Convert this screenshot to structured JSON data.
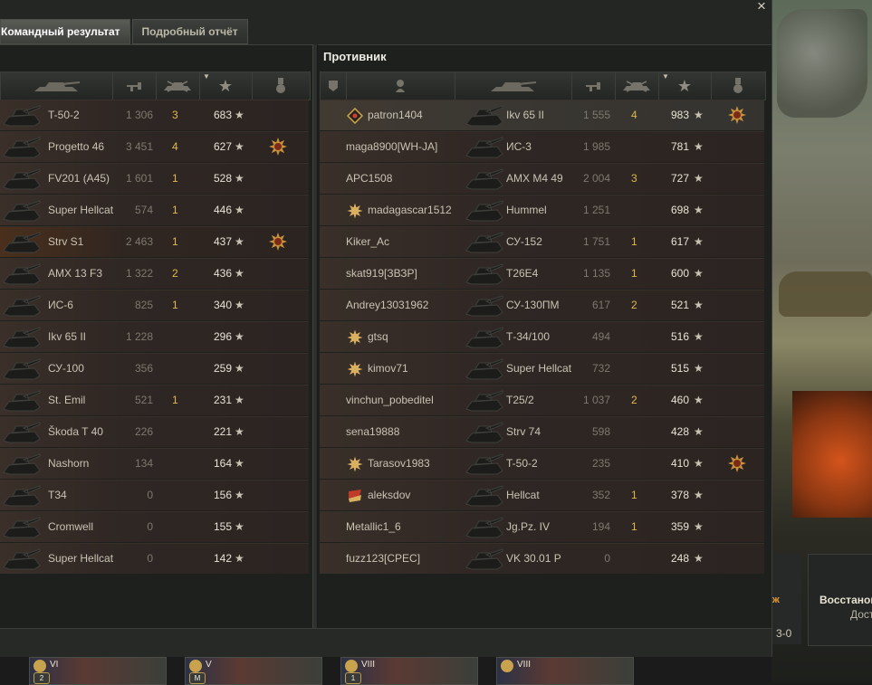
{
  "window": {
    "close_label": "×"
  },
  "tabs": [
    {
      "label": "Командный результат",
      "active": true
    },
    {
      "label": "Подробный отчёт",
      "active": false
    }
  ],
  "enemy_title": "Противник",
  "star": "★",
  "allies": [
    {
      "vehicle": "T-50-2",
      "damage": "1 306",
      "kills": "3",
      "xp": "683",
      "medal": false
    },
    {
      "vehicle": "Progetto 46",
      "damage": "3 451",
      "kills": "4",
      "xp": "627",
      "medal": true
    },
    {
      "vehicle": "FV201 (A45)",
      "damage": "1 601",
      "kills": "1",
      "xp": "528",
      "medal": false
    },
    {
      "vehicle": "Super Hellcat",
      "damage": "574",
      "kills": "1",
      "xp": "446",
      "medal": false
    },
    {
      "vehicle": "Strv S1",
      "damage": "2 463",
      "kills": "1",
      "xp": "437",
      "medal": true
    },
    {
      "vehicle": "AMX 13 F3",
      "damage": "1 322",
      "kills": "2",
      "xp": "436",
      "medal": false
    },
    {
      "vehicle": "ИС-6",
      "damage": "825",
      "kills": "1",
      "xp": "340",
      "medal": false
    },
    {
      "vehicle": "Ikv 65 II",
      "damage": "1 228",
      "kills": "",
      "xp": "296",
      "medal": false
    },
    {
      "vehicle": "СУ-100",
      "damage": "356",
      "kills": "",
      "xp": "259",
      "medal": false
    },
    {
      "vehicle": "St. Emil",
      "damage": "521",
      "kills": "1",
      "xp": "231",
      "medal": false
    },
    {
      "vehicle": "Škoda T 40",
      "damage": "226",
      "kills": "",
      "xp": "221",
      "medal": false
    },
    {
      "vehicle": "Nashorn",
      "damage": "134",
      "kills": "",
      "xp": "164",
      "medal": false
    },
    {
      "vehicle": "T34",
      "damage": "0",
      "kills": "",
      "xp": "156",
      "medal": false
    },
    {
      "vehicle": "Cromwell",
      "damage": "0",
      "kills": "",
      "xp": "155",
      "medal": false
    },
    {
      "vehicle": "Super Hellcat",
      "damage": "0",
      "kills": "",
      "xp": "142",
      "medal": false
    }
  ],
  "enemies": [
    {
      "player": "patron1404",
      "badge": "diamond",
      "vehicle": "Ikv 65 II",
      "damage": "1 555",
      "kills": "4",
      "xp": "983",
      "medal": true
    },
    {
      "player": "maga8900[WH-JA]",
      "badge": "",
      "vehicle": "ИС-3",
      "damage": "1 985",
      "kills": "",
      "xp": "781",
      "medal": false
    },
    {
      "player": "APC1508",
      "badge": "",
      "vehicle": "AMX M4 49",
      "damage": "2 004",
      "kills": "3",
      "xp": "727",
      "medal": false
    },
    {
      "player": "madagascar1512",
      "badge": "star",
      "vehicle": "Hummel",
      "damage": "1 251",
      "kills": "",
      "xp": "698",
      "medal": false
    },
    {
      "player": "Kiker_Ac",
      "badge": "",
      "vehicle": "СУ-152",
      "damage": "1 751",
      "kills": "1",
      "xp": "617",
      "medal": false
    },
    {
      "player": "skat919[ЗВЗР]",
      "badge": "",
      "vehicle": "T26E4",
      "damage": "1 135",
      "kills": "1",
      "xp": "600",
      "medal": false
    },
    {
      "player": "Andrey13031962",
      "badge": "",
      "vehicle": "СУ-130ПМ",
      "damage": "617",
      "kills": "2",
      "xp": "521",
      "medal": false
    },
    {
      "player": "gtsq",
      "badge": "star",
      "vehicle": "Т-34/100",
      "damage": "494",
      "kills": "",
      "xp": "516",
      "medal": false
    },
    {
      "player": "kimov71",
      "badge": "star",
      "vehicle": "Super Hellcat",
      "damage": "732",
      "kills": "",
      "xp": "515",
      "medal": false
    },
    {
      "player": "vinchun_pobeditel",
      "badge": "",
      "vehicle": "T25/2",
      "damage": "1 037",
      "kills": "2",
      "xp": "460",
      "medal": false
    },
    {
      "player": "sena19888",
      "badge": "",
      "vehicle": "Strv 74",
      "damage": "598",
      "kills": "",
      "xp": "428",
      "medal": false
    },
    {
      "player": "Tarasov1983",
      "badge": "star",
      "vehicle": "T-50-2",
      "damage": "235",
      "kills": "",
      "xp": "410",
      "medal": true
    },
    {
      "player": "aleksdov",
      "badge": "flag",
      "vehicle": "Hellcat",
      "damage": "352",
      "kills": "1",
      "xp": "378",
      "medal": false
    },
    {
      "player": "Metallic1_6",
      "badge": "",
      "vehicle": "Jg.Pz. IV",
      "damage": "194",
      "kills": "1",
      "xp": "359",
      "medal": false
    },
    {
      "player": "fuzz123[CPEC]",
      "badge": "",
      "vehicle": "VK 30.01 P",
      "damage": "0",
      "kills": "",
      "xp": "248",
      "medal": false
    }
  ],
  "side_panel": {
    "title": "Восстанов",
    "sub": "Дост",
    "left_a": "ж",
    "left_b": "3-0"
  },
  "carousel": [
    {
      "tier": "VI",
      "badge": "2",
      "level_text": ""
    },
    {
      "tier": "V",
      "badge": "M",
      "level_text": ""
    },
    {
      "tier": "VIII",
      "badge": "1",
      "level_text": ""
    },
    {
      "tier": "VIII",
      "badge": "",
      "level_text": ""
    }
  ],
  "colors": {
    "accent_gold": "#e2b84d",
    "row_bg": "#2f2724",
    "header_bg": "#343633"
  },
  "icons": {
    "header_ally": [
      "tank-icon",
      "damage-icon",
      "kills-icon",
      "xp-star-icon",
      "medal-icon"
    ],
    "header_enemy": [
      "squad-icon",
      "player-icon",
      "tank-icon",
      "damage-icon",
      "kills-icon",
      "xp-star-icon",
      "medal-icon"
    ]
  }
}
